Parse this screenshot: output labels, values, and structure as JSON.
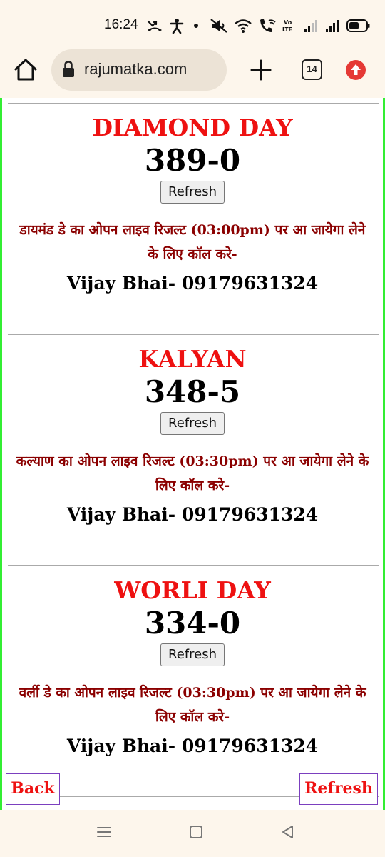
{
  "status_bar": {
    "time": "16:24",
    "icons": [
      "missed-call-icon",
      "accessibility-icon",
      "dot-icon",
      "mute-icon",
      "wifi-icon",
      "wifi-calling-icon",
      "volte-icon",
      "signal-icon",
      "signal-icon",
      "battery-icon"
    ]
  },
  "browser": {
    "url": "rajumatka.com",
    "tab_count": "14",
    "colors": {
      "update_badge": "#e53935"
    }
  },
  "markets": [
    {
      "name": "DIAMOND DAY",
      "result": "389-0",
      "refresh_label": "Refresh",
      "info": "डायमंड डे का ओपन लाइव रिजल्ट (03:00pm) पर आ जायेगा लेने के लिए कॉल करे-",
      "contact": "Vijay Bhai- 09179631324"
    },
    {
      "name": "KALYAN",
      "result": "348-5",
      "refresh_label": "Refresh",
      "info": "कल्याण का ओपन लाइव रिजल्ट (03:30pm) पर आ जायेगा लेने के लिए कॉल करे-",
      "contact": "Vijay Bhai- 09179631324"
    },
    {
      "name": "WORLI DAY",
      "result": "334-0",
      "refresh_label": "Refresh",
      "info": "वर्ली डे का ओपन लाइव रिजल्ट (03:30pm) पर आ जायेगा लेने के लिए कॉल करे-",
      "contact": "Vijay Bhai- 09179631324"
    }
  ],
  "fixed_buttons": {
    "back_label": "Back",
    "refresh_label": "Refresh"
  },
  "colors": {
    "title": "#ee1111",
    "info": "#8b0000",
    "page_border": "#33ee33",
    "fixed_button_border": "#7b3fbf"
  }
}
